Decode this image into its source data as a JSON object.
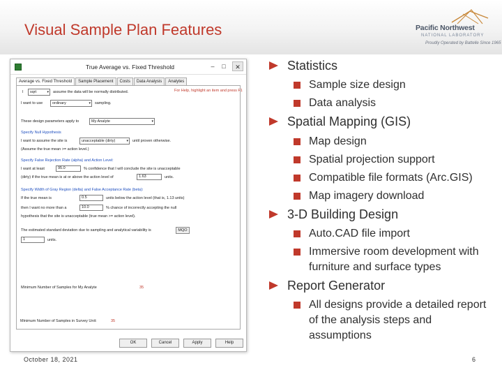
{
  "title": "Visual Sample Plan Features",
  "logo": {
    "line1": "Pacific Northwest",
    "line2": "NATIONAL LABORATORY",
    "line3": "Proudly Operated by Battelle Since 1965"
  },
  "dialog": {
    "title": "True Average vs. Fixed Threshold",
    "tabs": [
      "Average vs. Fixed Threshold",
      "Sample Placement",
      "Costs",
      "Data Analysis",
      "Analytes"
    ],
    "help_text": "For Help, highlight an item and press F1",
    "assume_value": "sqrt",
    "assume_text": "assume the data will be normally distributed.",
    "want_label": "I want to use",
    "want_value": "ordinary",
    "sampling": "sampling.",
    "design_params_label": "These design parameters apply to",
    "analyte_value": "My Analyte",
    "null_hyp_heading": "Specify Null Hypothesis",
    "assume_site_label": "I want to assume the site is",
    "site_value": "unacceptable (dirty)",
    "until_text": "until proven otherwise.",
    "assume_true_mean": "(Assume the true mean >= action level.)",
    "false_rejection_heading": "Specify False Rejection Rate (alpha) and Action Level:",
    "want_least": "I want at least",
    "confidence_value": "95.0",
    "confidence_text": "% confidence that I will conclude the site is unacceptable",
    "dirty_text": "(dirty) if the true mean is at or above the action level of",
    "action_level": "1.63",
    "units": "units.",
    "gray_region_heading": "Specify Width of Gray Region (delta) and False Acceptance Rate (beta):",
    "if_true_mean": "If the true mean is",
    "delta_value": "0.5",
    "below_text": "units below the action level (that is, 1.13 units)",
    "then_want": "then I want no more than a",
    "beta_value": "10.0",
    "chance_text": "% chance of incorrectly accepting the null",
    "hypothesis_text": "hypothesis that the site is unacceptable (true mean >= action level).",
    "std_dev_text": "The estimated standard deviation due to sampling and analytical variability is",
    "mqo_label": "MQO",
    "std_value": "1",
    "std_units": "units.",
    "min_samples_analyte_label": "Minimum Number of Samples for My Analyte",
    "min_samples_analyte_value": "35",
    "min_samples_survey_label": "Minimum Number of Samples in Survey Unit:",
    "min_samples_survey_value": "35",
    "ok": "OK",
    "cancel": "Cancel",
    "apply": "Apply",
    "help": "Help"
  },
  "bullets": [
    {
      "label": "Statistics",
      "items": [
        "Sample size design",
        "Data analysis"
      ]
    },
    {
      "label": "Spatial Mapping (GIS)",
      "items": [
        "Map design",
        "Spatial projection support",
        "Compatible file formats (Arc.GIS)",
        "Map imagery download"
      ]
    },
    {
      "label": "3-D Building Design",
      "items": [
        "Auto.CAD file import",
        "Immersive room development with furniture and surface types"
      ]
    },
    {
      "label": "Report Generator",
      "items": [
        "All designs provide a detailed report of the analysis steps and assumptions"
      ]
    }
  ],
  "footer": {
    "date": "October 18, 2021",
    "page": "6"
  },
  "colors": {
    "accent": "#c0392b",
    "text": "#2f2f2f"
  }
}
